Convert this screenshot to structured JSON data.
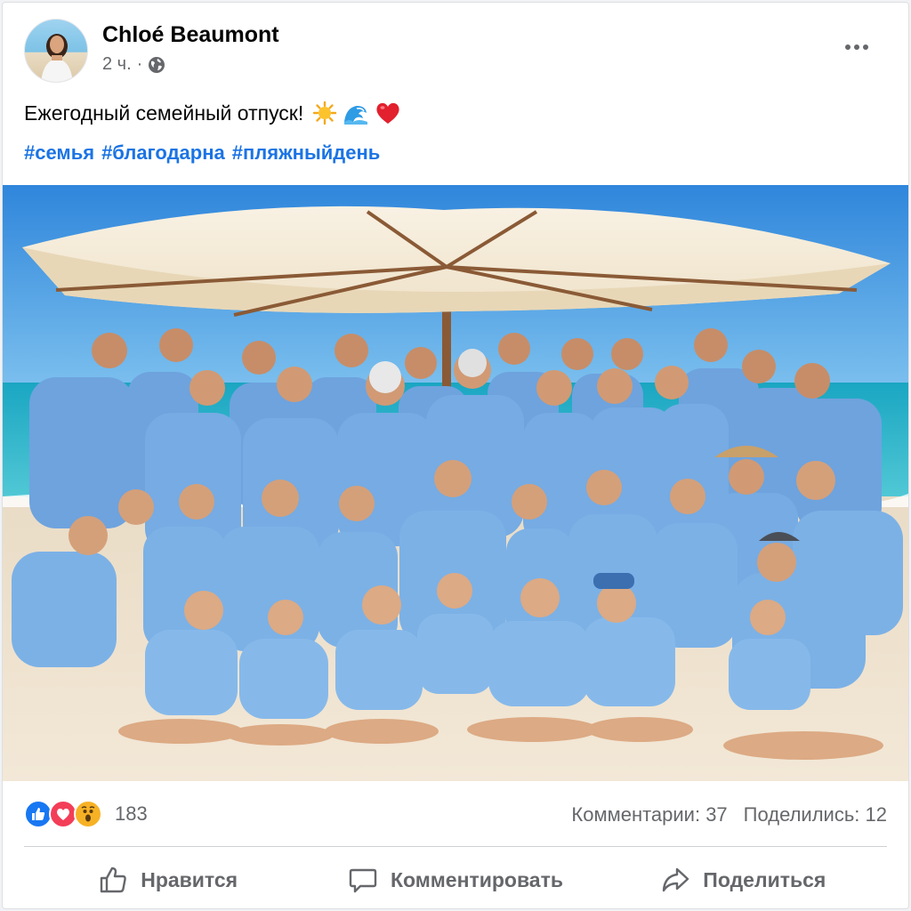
{
  "post": {
    "author": "Chloé Beaumont",
    "time": "2 ч.",
    "separator": "·",
    "privacy_icon": "globe-icon",
    "more_icon": "more-options-icon",
    "text": "Ежегодный семейный отпуск!",
    "emojis": [
      "sun-emoji",
      "wave-emoji",
      "heart-emoji"
    ],
    "hashtags": [
      "#семья",
      "#благодарна",
      "#пляжныйдень"
    ]
  },
  "reactions": {
    "icons": [
      "like-icon",
      "love-icon",
      "wow-icon"
    ],
    "count": "183",
    "comments": "Комментарии: 37",
    "shares": "Поделились: 12"
  },
  "actions": {
    "like": "Нравится",
    "comment": "Комментировать",
    "share": "Поделиться"
  },
  "colors": {
    "accent": "#1b74e4",
    "like_blue": "#1877f2",
    "love_red": "#f33e58",
    "wow_yellow": "#f7b125",
    "secondary_text": "#65676b"
  }
}
